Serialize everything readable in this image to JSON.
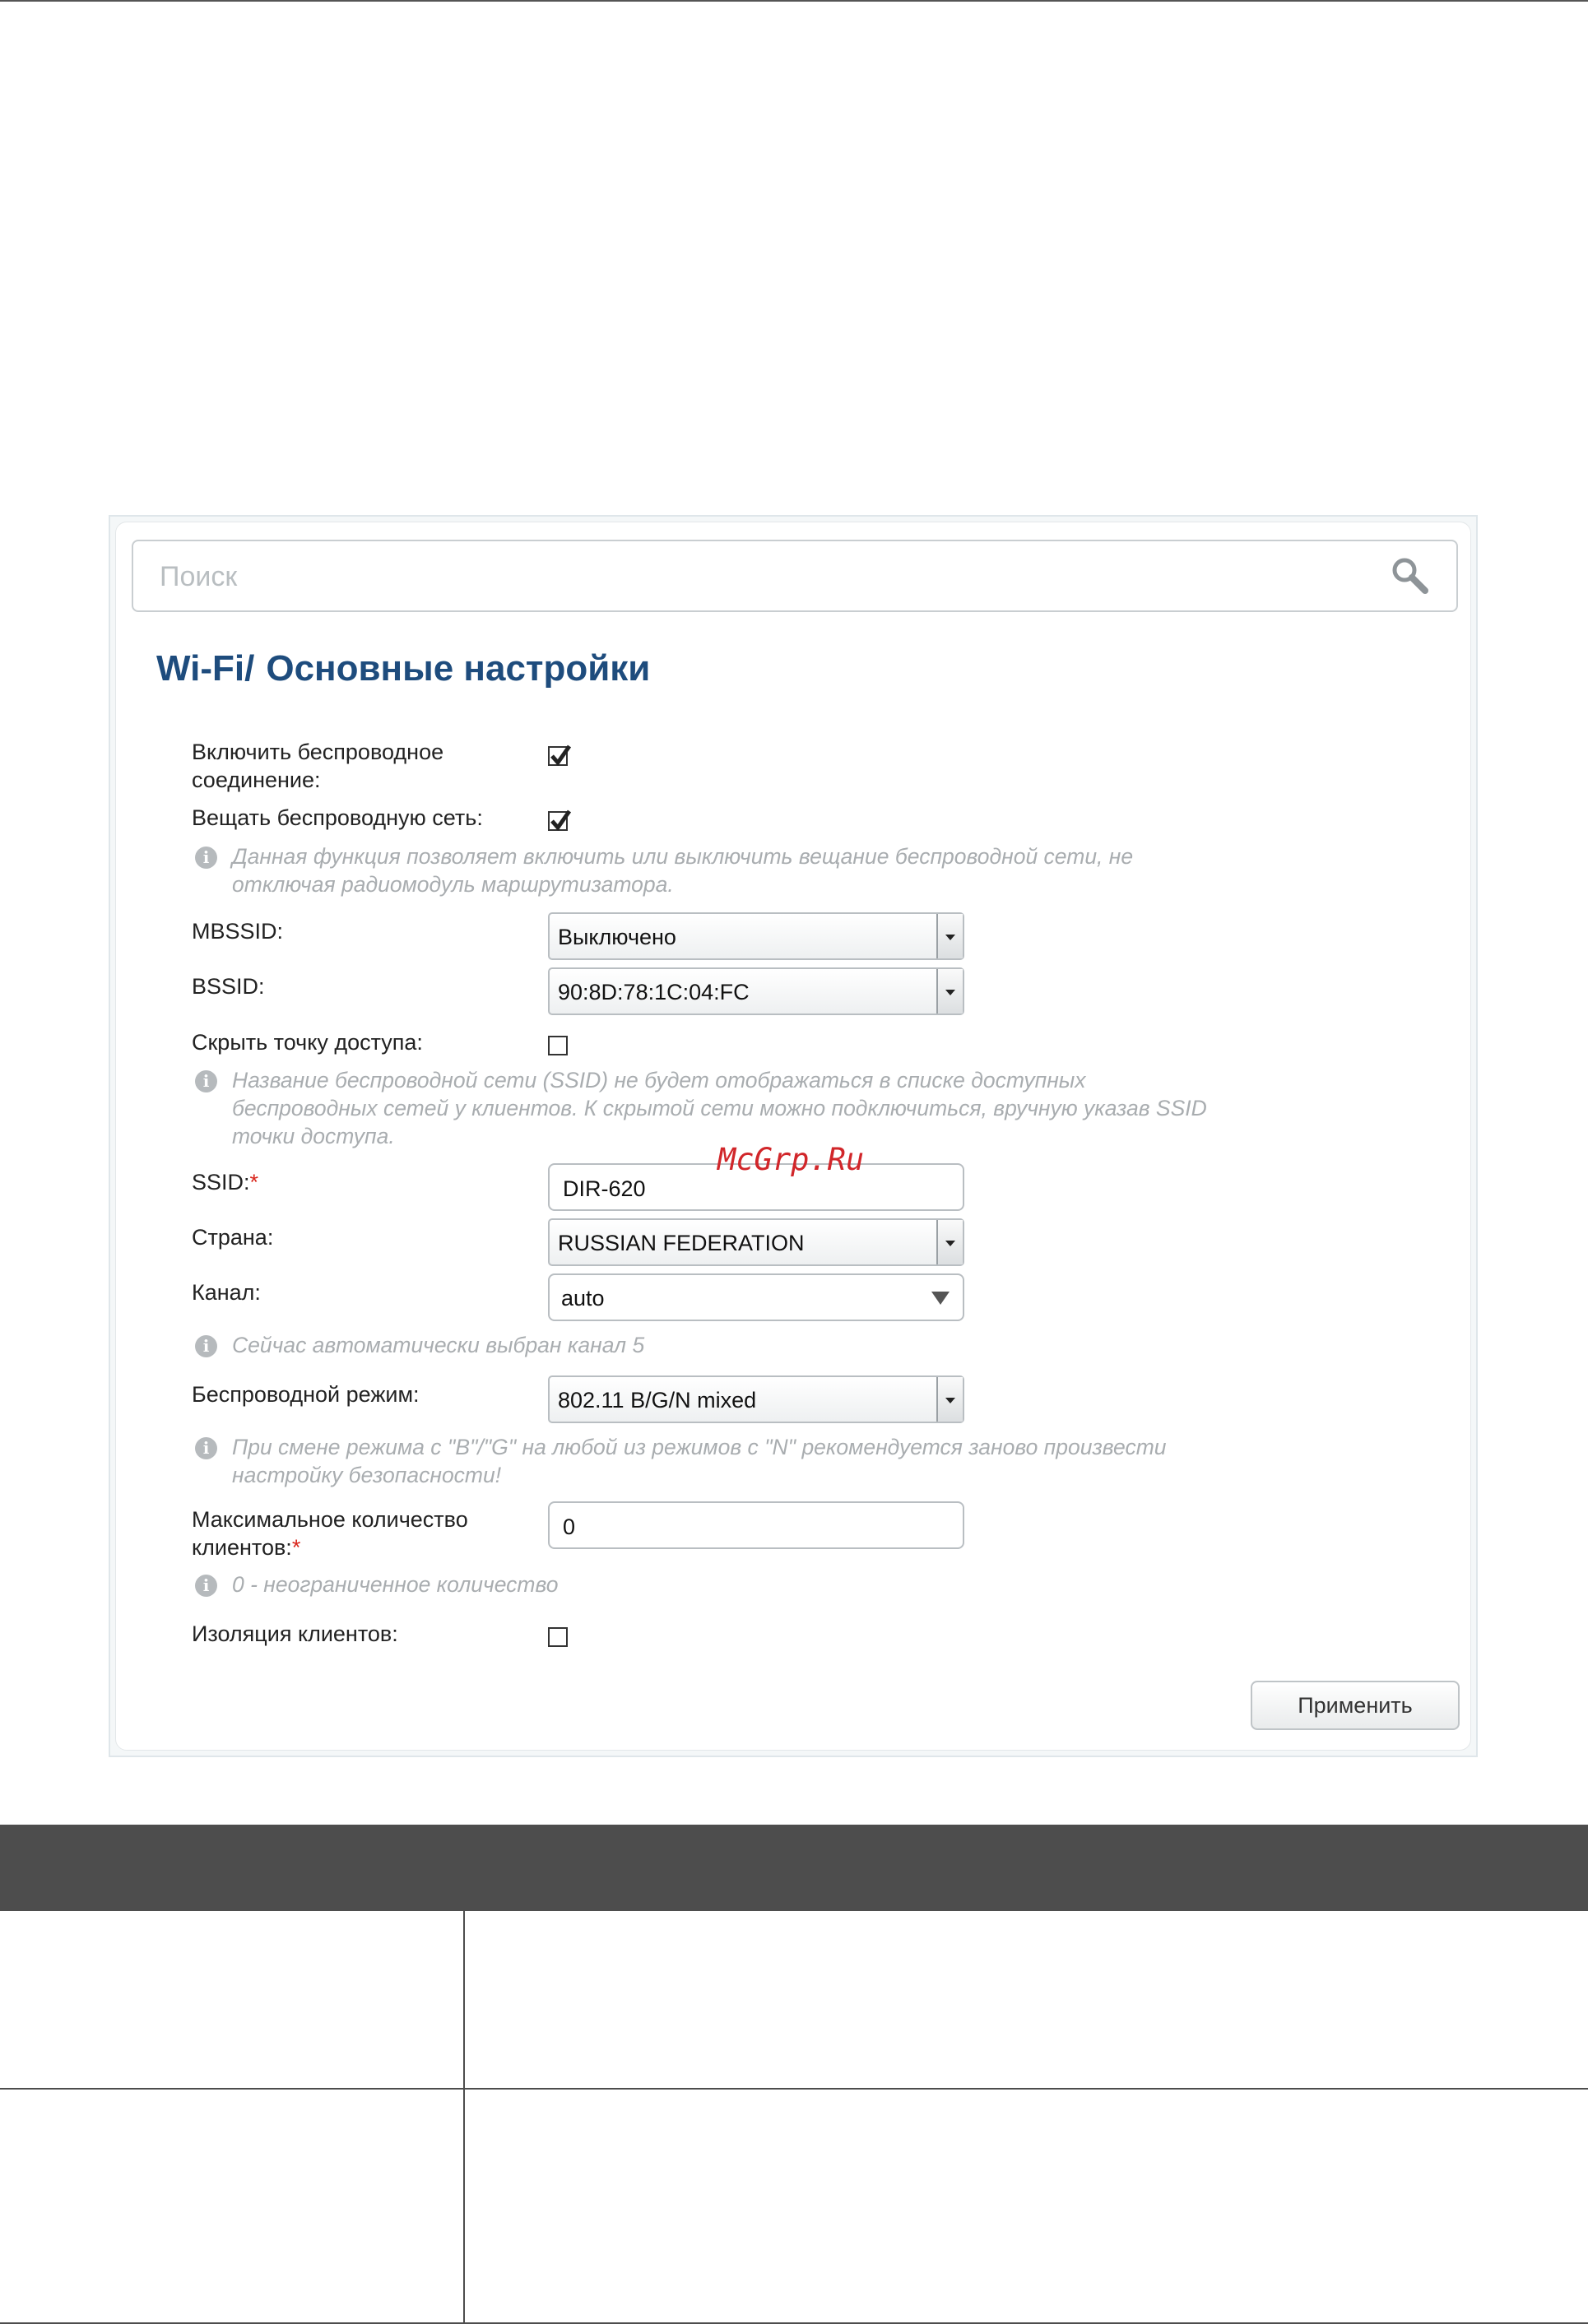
{
  "search": {
    "placeholder": "Поиск"
  },
  "breadcrumb": {
    "section": "Wi-Fi",
    "separator": "/",
    "page": "Основные настройки"
  },
  "form": {
    "enable_wireless": {
      "label": "Включить беспроводное соединение:",
      "checked": true
    },
    "broadcast": {
      "label": "Вещать беспроводную сеть:",
      "checked": true
    },
    "broadcast_hint": "Данная функция позволяет включить или выключить вещание беспроводной сети, не отключая радиомодуль маршрутизатора.",
    "mbssid": {
      "label": "MBSSID:",
      "value": "Выключено"
    },
    "bssid": {
      "label": "BSSID:",
      "value": "90:8D:78:1C:04:FC"
    },
    "hide_ap": {
      "label": "Скрыть точку доступа:",
      "checked": false
    },
    "hide_ap_hint": "Название беспроводной сети (SSID) не будет отображаться в списке доступных беспроводных сетей у клиентов. К скрытой сети можно подключиться, вручную указав SSID точки доступа.",
    "ssid": {
      "label": "SSID:",
      "required_mark": "*",
      "value": "DIR-620"
    },
    "country": {
      "label": "Страна:",
      "value": "RUSSIAN FEDERATION"
    },
    "channel": {
      "label": "Канал:",
      "value": "auto"
    },
    "channel_hint": "Сейчас автоматически выбран канал 5",
    "wireless_mode": {
      "label": "Беспроводной режим:",
      "value": "802.11 B/G/N mixed"
    },
    "wireless_mode_hint": "При смене режима с \"B\"/\"G\" на любой из режимов с \"N\" рекомендуется заново произвести настройку безопасности!",
    "max_clients": {
      "label": "Максимальное количество клиентов:",
      "required_mark": "*",
      "value": "0"
    },
    "max_clients_hint": "0 - неограниченное количество",
    "client_isolation": {
      "label": "Изоляция клиентов:",
      "checked": false
    }
  },
  "apply_label": "Применить",
  "watermark": "McGrp.Ru",
  "colors": {
    "title": "#1e4c7d",
    "required": "#d9261c",
    "table_header": "#4d4d4d"
  }
}
